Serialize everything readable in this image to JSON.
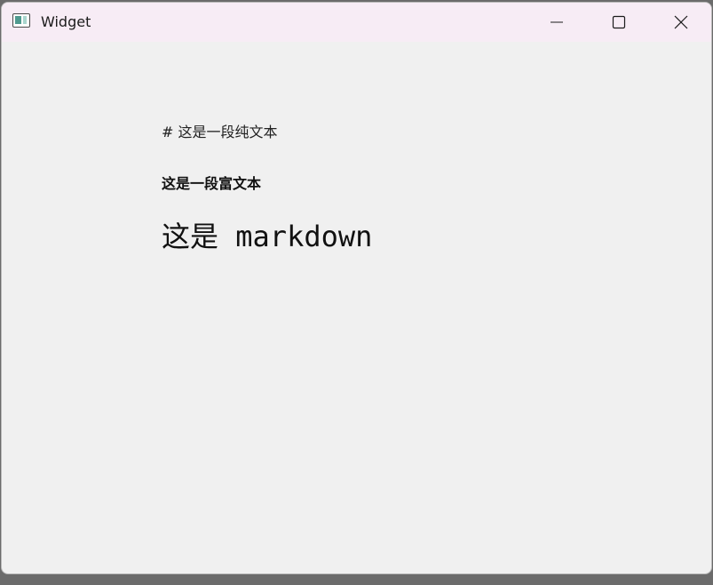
{
  "window": {
    "title": "Widget",
    "icon": "qt-app-window-icon",
    "controls": {
      "minimize": "minimize-icon",
      "maximize": "maximize-icon",
      "close": "close-icon"
    }
  },
  "content": {
    "plain_text": "# 这是一段纯文本",
    "rich_text": "这是一段富文本",
    "markdown_heading": "这是 markdown"
  },
  "colors": {
    "titlebar": "#f7ecf5",
    "window_bg": "#f0f0f0",
    "text": "#111111"
  }
}
